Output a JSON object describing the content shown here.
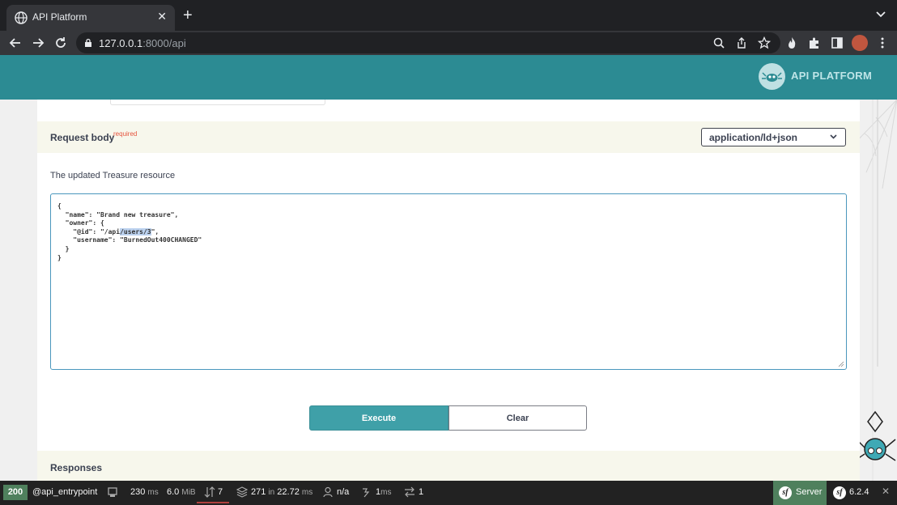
{
  "browser": {
    "tab_title": "API Platform",
    "tab_close": "✕",
    "new_tab": "+",
    "url_host": "127.0.0.1",
    "url_rest": ":8000/api"
  },
  "header": {
    "brand": "API PLATFORM"
  },
  "request": {
    "label": "Request body",
    "required": "required",
    "content_type": "application/ld+json",
    "description": "The updated Treasure resource",
    "body_line1": "{",
    "body_line2": "  \"name\": \"Brand new treasure\",",
    "body_line3": "  \"owner\": {",
    "body_line4a": "    \"@id\": \"/api",
    "body_line4_highlight": "/users/3",
    "body_line4b": "\",",
    "body_line5": "    \"username\": \"BurnedOut400CHANGED\"",
    "body_line6": "  }",
    "body_line7": "}",
    "execute_label": "Execute",
    "clear_label": "Clear"
  },
  "responses": {
    "label": "Responses"
  },
  "sf_toolbar": {
    "status": "200",
    "route": "@api_entrypoint",
    "time_value": "230",
    "time_unit": "ms",
    "memory_value": "6.0",
    "memory_unit": "MiB",
    "requests": "7",
    "queries_value": "271",
    "queries_in": "in",
    "queries_time": "22.72",
    "queries_unit": "ms",
    "user": "n/a",
    "events_value": "1",
    "events_unit": "ms",
    "forms": "1",
    "server_label": "Server",
    "version": "6.2.4",
    "close": "✕"
  },
  "colors": {
    "header_teal": "#2c8b93",
    "execute": "#3fa0a8",
    "status_green": "#4f805d",
    "panel_cream": "#f7f7ec"
  }
}
